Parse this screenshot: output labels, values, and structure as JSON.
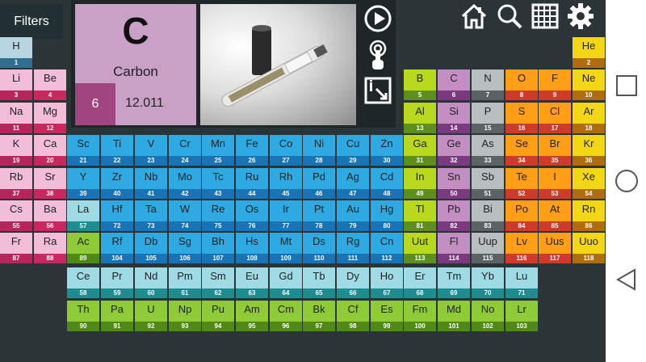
{
  "header": {
    "filters_label": "Filters"
  },
  "detail": {
    "symbol": "C",
    "name": "Carbon",
    "number": "6",
    "mass": "12.011"
  },
  "icons": {
    "play": "play-icon",
    "touch": "touch-icon",
    "export": "export-icon",
    "home": "home-icon",
    "search": "search-icon",
    "grid": "grid-icon",
    "settings": "gear-icon"
  },
  "android_nav": {
    "square": "recent-apps-icon",
    "circle": "home-circle-icon",
    "triangle": "back-triangle-icon"
  },
  "colors": {
    "alkali": [
      "#f1bdd8",
      "#b5265a"
    ],
    "alkaline": [
      "#f1bdd8",
      "#c7295e"
    ],
    "transition": [
      "#2fa9e1",
      "#1a73b5"
    ],
    "lanthanide": [
      "#9fdbe4",
      "#1d8d92"
    ],
    "actinide": [
      "#8ecb37",
      "#4f8a17"
    ],
    "post_transition": [
      "#b8d91c",
      "#5c8f1d"
    ],
    "metalloid": [
      "#c38fc3",
      "#7b3a80"
    ],
    "nonmetal": [
      "#ff9e17",
      "#cf3b2a"
    ],
    "noble": [
      "#f3d714",
      "#b06d10"
    ],
    "hydrogen": [
      "#b8d5e2",
      "#2f6f8f"
    ],
    "unknown": [
      "#b8bdbe",
      "#5b6365"
    ]
  },
  "elements": [
    {
      "sym": "H",
      "num": "1",
      "col": 1,
      "row": 1,
      "cat": "hydrogen"
    },
    {
      "sym": "He",
      "num": "2",
      "col": 18,
      "row": 1,
      "cat": "noble"
    },
    {
      "sym": "Li",
      "num": "3",
      "col": 1,
      "row": 2,
      "cat": "alkali"
    },
    {
      "sym": "Be",
      "num": "4",
      "col": 2,
      "row": 2,
      "cat": "alkaline"
    },
    {
      "sym": "B",
      "num": "5",
      "col": 13,
      "row": 2,
      "cat": "post_transition"
    },
    {
      "sym": "C",
      "num": "6",
      "col": 14,
      "row": 2,
      "cat": "metalloid"
    },
    {
      "sym": "N",
      "num": "7",
      "col": 15,
      "row": 2,
      "cat": "unknown"
    },
    {
      "sym": "O",
      "num": "8",
      "col": 16,
      "row": 2,
      "cat": "nonmetal"
    },
    {
      "sym": "F",
      "num": "9",
      "col": 17,
      "row": 2,
      "cat": "nonmetal"
    },
    {
      "sym": "Ne",
      "num": "10",
      "col": 18,
      "row": 2,
      "cat": "noble"
    },
    {
      "sym": "Na",
      "num": "11",
      "col": 1,
      "row": 3,
      "cat": "alkali"
    },
    {
      "sym": "Mg",
      "num": "12",
      "col": 2,
      "row": 3,
      "cat": "alkaline"
    },
    {
      "sym": "Al",
      "num": "13",
      "col": 13,
      "row": 3,
      "cat": "post_transition"
    },
    {
      "sym": "Si",
      "num": "14",
      "col": 14,
      "row": 3,
      "cat": "metalloid"
    },
    {
      "sym": "P",
      "num": "15",
      "col": 15,
      "row": 3,
      "cat": "unknown"
    },
    {
      "sym": "S",
      "num": "16",
      "col": 16,
      "row": 3,
      "cat": "nonmetal"
    },
    {
      "sym": "Cl",
      "num": "17",
      "col": 17,
      "row": 3,
      "cat": "nonmetal"
    },
    {
      "sym": "Ar",
      "num": "18",
      "col": 18,
      "row": 3,
      "cat": "noble"
    },
    {
      "sym": "K",
      "num": "19",
      "col": 1,
      "row": 4,
      "cat": "alkali"
    },
    {
      "sym": "Ca",
      "num": "20",
      "col": 2,
      "row": 4,
      "cat": "alkaline"
    },
    {
      "sym": "Sc",
      "num": "21",
      "col": 3,
      "row": 4,
      "cat": "transition"
    },
    {
      "sym": "Ti",
      "num": "22",
      "col": 4,
      "row": 4,
      "cat": "transition"
    },
    {
      "sym": "V",
      "num": "23",
      "col": 5,
      "row": 4,
      "cat": "transition"
    },
    {
      "sym": "Cr",
      "num": "24",
      "col": 6,
      "row": 4,
      "cat": "transition"
    },
    {
      "sym": "Mn",
      "num": "25",
      "col": 7,
      "row": 4,
      "cat": "transition"
    },
    {
      "sym": "Fe",
      "num": "26",
      "col": 8,
      "row": 4,
      "cat": "transition"
    },
    {
      "sym": "Co",
      "num": "27",
      "col": 9,
      "row": 4,
      "cat": "transition"
    },
    {
      "sym": "Ni",
      "num": "28",
      "col": 10,
      "row": 4,
      "cat": "transition"
    },
    {
      "sym": "Cu",
      "num": "29",
      "col": 11,
      "row": 4,
      "cat": "transition"
    },
    {
      "sym": "Zn",
      "num": "30",
      "col": 12,
      "row": 4,
      "cat": "transition"
    },
    {
      "sym": "Ga",
      "num": "31",
      "col": 13,
      "row": 4,
      "cat": "post_transition"
    },
    {
      "sym": "Ge",
      "num": "32",
      "col": 14,
      "row": 4,
      "cat": "metalloid"
    },
    {
      "sym": "As",
      "num": "33",
      "col": 15,
      "row": 4,
      "cat": "unknown"
    },
    {
      "sym": "Se",
      "num": "34",
      "col": 16,
      "row": 4,
      "cat": "nonmetal"
    },
    {
      "sym": "Br",
      "num": "35",
      "col": 17,
      "row": 4,
      "cat": "nonmetal"
    },
    {
      "sym": "Kr",
      "num": "36",
      "col": 18,
      "row": 4,
      "cat": "noble"
    },
    {
      "sym": "Rb",
      "num": "37",
      "col": 1,
      "row": 5,
      "cat": "alkali"
    },
    {
      "sym": "Sr",
      "num": "38",
      "col": 2,
      "row": 5,
      "cat": "alkaline"
    },
    {
      "sym": "Y",
      "num": "39",
      "col": 3,
      "row": 5,
      "cat": "transition"
    },
    {
      "sym": "Zr",
      "num": "40",
      "col": 4,
      "row": 5,
      "cat": "transition"
    },
    {
      "sym": "Nb",
      "num": "41",
      "col": 5,
      "row": 5,
      "cat": "transition"
    },
    {
      "sym": "Mo",
      "num": "42",
      "col": 6,
      "row": 5,
      "cat": "transition"
    },
    {
      "sym": "Tc",
      "num": "43",
      "col": 7,
      "row": 5,
      "cat": "transition"
    },
    {
      "sym": "Ru",
      "num": "44",
      "col": 8,
      "row": 5,
      "cat": "transition"
    },
    {
      "sym": "Rh",
      "num": "45",
      "col": 9,
      "row": 5,
      "cat": "transition"
    },
    {
      "sym": "Pd",
      "num": "46",
      "col": 10,
      "row": 5,
      "cat": "transition"
    },
    {
      "sym": "Ag",
      "num": "47",
      "col": 11,
      "row": 5,
      "cat": "transition"
    },
    {
      "sym": "Cd",
      "num": "48",
      "col": 12,
      "row": 5,
      "cat": "transition"
    },
    {
      "sym": "In",
      "num": "49",
      "col": 13,
      "row": 5,
      "cat": "post_transition"
    },
    {
      "sym": "Sn",
      "num": "50",
      "col": 14,
      "row": 5,
      "cat": "metalloid"
    },
    {
      "sym": "Sb",
      "num": "51",
      "col": 15,
      "row": 5,
      "cat": "unknown"
    },
    {
      "sym": "Te",
      "num": "52",
      "col": 16,
      "row": 5,
      "cat": "nonmetal"
    },
    {
      "sym": "I",
      "num": "53",
      "col": 17,
      "row": 5,
      "cat": "nonmetal"
    },
    {
      "sym": "Xe",
      "num": "54",
      "col": 18,
      "row": 5,
      "cat": "noble"
    },
    {
      "sym": "Cs",
      "num": "55",
      "col": 1,
      "row": 6,
      "cat": "alkali"
    },
    {
      "sym": "Ba",
      "num": "56",
      "col": 2,
      "row": 6,
      "cat": "alkaline"
    },
    {
      "sym": "La",
      "num": "57",
      "col": 3,
      "row": 6,
      "cat": "lanthanide"
    },
    {
      "sym": "Hf",
      "num": "72",
      "col": 4,
      "row": 6,
      "cat": "transition"
    },
    {
      "sym": "Ta",
      "num": "73",
      "col": 5,
      "row": 6,
      "cat": "transition"
    },
    {
      "sym": "W",
      "num": "74",
      "col": 6,
      "row": 6,
      "cat": "transition"
    },
    {
      "sym": "Re",
      "num": "75",
      "col": 7,
      "row": 6,
      "cat": "transition"
    },
    {
      "sym": "Os",
      "num": "76",
      "col": 8,
      "row": 6,
      "cat": "transition"
    },
    {
      "sym": "Ir",
      "num": "77",
      "col": 9,
      "row": 6,
      "cat": "transition"
    },
    {
      "sym": "Pt",
      "num": "78",
      "col": 10,
      "row": 6,
      "cat": "transition"
    },
    {
      "sym": "Au",
      "num": "79",
      "col": 11,
      "row": 6,
      "cat": "transition"
    },
    {
      "sym": "Hg",
      "num": "80",
      "col": 12,
      "row": 6,
      "cat": "transition"
    },
    {
      "sym": "Tl",
      "num": "81",
      "col": 13,
      "row": 6,
      "cat": "post_transition"
    },
    {
      "sym": "Pb",
      "num": "82",
      "col": 14,
      "row": 6,
      "cat": "metalloid"
    },
    {
      "sym": "Bi",
      "num": "83",
      "col": 15,
      "row": 6,
      "cat": "unknown"
    },
    {
      "sym": "Po",
      "num": "84",
      "col": 16,
      "row": 6,
      "cat": "nonmetal"
    },
    {
      "sym": "At",
      "num": "85",
      "col": 17,
      "row": 6,
      "cat": "nonmetal"
    },
    {
      "sym": "Rn",
      "num": "86",
      "col": 18,
      "row": 6,
      "cat": "noble"
    },
    {
      "sym": "Fr",
      "num": "87",
      "col": 1,
      "row": 7,
      "cat": "alkali"
    },
    {
      "sym": "Ra",
      "num": "88",
      "col": 2,
      "row": 7,
      "cat": "alkaline"
    },
    {
      "sym": "Ac",
      "num": "89",
      "col": 3,
      "row": 7,
      "cat": "actinide"
    },
    {
      "sym": "Rf",
      "num": "104",
      "col": 4,
      "row": 7,
      "cat": "transition"
    },
    {
      "sym": "Db",
      "num": "105",
      "col": 5,
      "row": 7,
      "cat": "transition"
    },
    {
      "sym": "Sg",
      "num": "106",
      "col": 6,
      "row": 7,
      "cat": "transition"
    },
    {
      "sym": "Bh",
      "num": "107",
      "col": 7,
      "row": 7,
      "cat": "transition"
    },
    {
      "sym": "Hs",
      "num": "108",
      "col": 8,
      "row": 7,
      "cat": "transition"
    },
    {
      "sym": "Mt",
      "num": "109",
      "col": 9,
      "row": 7,
      "cat": "transition"
    },
    {
      "sym": "Ds",
      "num": "110",
      "col": 10,
      "row": 7,
      "cat": "transition"
    },
    {
      "sym": "Rg",
      "num": "111",
      "col": 11,
      "row": 7,
      "cat": "transition"
    },
    {
      "sym": "Cn",
      "num": "112",
      "col": 12,
      "row": 7,
      "cat": "transition"
    },
    {
      "sym": "Uut",
      "num": "113",
      "col": 13,
      "row": 7,
      "cat": "post_transition"
    },
    {
      "sym": "Fl",
      "num": "114",
      "col": 14,
      "row": 7,
      "cat": "metalloid"
    },
    {
      "sym": "Uup",
      "num": "115",
      "col": 15,
      "row": 7,
      "cat": "unknown"
    },
    {
      "sym": "Lv",
      "num": "116",
      "col": 16,
      "row": 7,
      "cat": "nonmetal"
    },
    {
      "sym": "Uus",
      "num": "117",
      "col": 17,
      "row": 7,
      "cat": "nonmetal"
    },
    {
      "sym": "Uuo",
      "num": "118",
      "col": 18,
      "row": 7,
      "cat": "noble"
    },
    {
      "sym": "Ce",
      "num": "58",
      "col": 3,
      "row": 8,
      "cat": "lanthanide"
    },
    {
      "sym": "Pr",
      "num": "59",
      "col": 4,
      "row": 8,
      "cat": "lanthanide"
    },
    {
      "sym": "Nd",
      "num": "60",
      "col": 5,
      "row": 8,
      "cat": "lanthanide"
    },
    {
      "sym": "Pm",
      "num": "61",
      "col": 6,
      "row": 8,
      "cat": "lanthanide"
    },
    {
      "sym": "Sm",
      "num": "62",
      "col": 7,
      "row": 8,
      "cat": "lanthanide"
    },
    {
      "sym": "Eu",
      "num": "63",
      "col": 8,
      "row": 8,
      "cat": "lanthanide"
    },
    {
      "sym": "Gd",
      "num": "64",
      "col": 9,
      "row": 8,
      "cat": "lanthanide"
    },
    {
      "sym": "Tb",
      "num": "65",
      "col": 10,
      "row": 8,
      "cat": "lanthanide"
    },
    {
      "sym": "Dy",
      "num": "66",
      "col": 11,
      "row": 8,
      "cat": "lanthanide"
    },
    {
      "sym": "Ho",
      "num": "67",
      "col": 12,
      "row": 8,
      "cat": "lanthanide"
    },
    {
      "sym": "Er",
      "num": "68",
      "col": 13,
      "row": 8,
      "cat": "lanthanide"
    },
    {
      "sym": "Tm",
      "num": "69",
      "col": 14,
      "row": 8,
      "cat": "lanthanide"
    },
    {
      "sym": "Yb",
      "num": "70",
      "col": 15,
      "row": 8,
      "cat": "lanthanide"
    },
    {
      "sym": "Lu",
      "num": "71",
      "col": 16,
      "row": 8,
      "cat": "lanthanide"
    },
    {
      "sym": "Th",
      "num": "90",
      "col": 3,
      "row": 9,
      "cat": "actinide"
    },
    {
      "sym": "Pa",
      "num": "91",
      "col": 4,
      "row": 9,
      "cat": "actinide"
    },
    {
      "sym": "U",
      "num": "92",
      "col": 5,
      "row": 9,
      "cat": "actinide"
    },
    {
      "sym": "Np",
      "num": "93",
      "col": 6,
      "row": 9,
      "cat": "actinide"
    },
    {
      "sym": "Pu",
      "num": "94",
      "col": 7,
      "row": 9,
      "cat": "actinide"
    },
    {
      "sym": "Am",
      "num": "95",
      "col": 8,
      "row": 9,
      "cat": "actinide"
    },
    {
      "sym": "Cm",
      "num": "96",
      "col": 9,
      "row": 9,
      "cat": "actinide"
    },
    {
      "sym": "Bk",
      "num": "97",
      "col": 10,
      "row": 9,
      "cat": "actinide"
    },
    {
      "sym": "Cf",
      "num": "98",
      "col": 11,
      "row": 9,
      "cat": "actinide"
    },
    {
      "sym": "Es",
      "num": "99",
      "col": 12,
      "row": 9,
      "cat": "actinide"
    },
    {
      "sym": "Fm",
      "num": "100",
      "col": 13,
      "row": 9,
      "cat": "actinide"
    },
    {
      "sym": "Md",
      "num": "101",
      "col": 14,
      "row": 9,
      "cat": "actinide"
    },
    {
      "sym": "No",
      "num": "102",
      "col": 15,
      "row": 9,
      "cat": "actinide"
    },
    {
      "sym": "Lr",
      "num": "103",
      "col": 16,
      "row": 9,
      "cat": "actinide"
    }
  ]
}
